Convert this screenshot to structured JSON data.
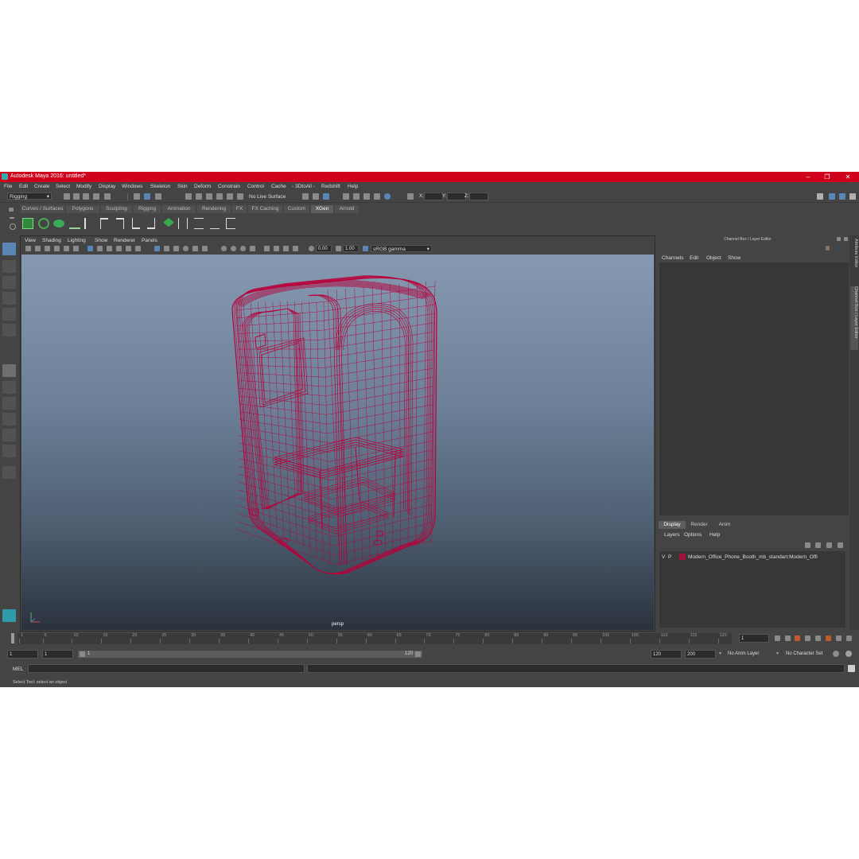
{
  "title": "Autodesk Maya 2016: untitled*",
  "window_buttons": [
    "–",
    "❐",
    "✕"
  ],
  "menu": [
    "File",
    "Edit",
    "Create",
    "Select",
    "Modify",
    "Display",
    "Windows",
    "Skeleton",
    "Skin",
    "Deform",
    "Constrain",
    "Control",
    "Cache",
    "- 3DtoAll -",
    "Redshift",
    "Help"
  ],
  "status_line": {
    "mode": "Rigging",
    "live_surface": "No Live Surface",
    "x_label": "X:",
    "y_label": "Y:",
    "z_label": "Z:"
  },
  "shelf_tabs": [
    "Curves / Surfaces",
    "Polygons",
    "Sculpting",
    "Rigging",
    "Animation",
    "Rendering",
    "FX",
    "FX Caching",
    "Custom",
    "XGen",
    "Arnold"
  ],
  "active_shelf_tab": "XGen",
  "viewport": {
    "menu": [
      "View",
      "Shading",
      "Lighting",
      "Show",
      "Renderer",
      "Panels"
    ],
    "exposure": "0.00",
    "gamma": "1.00",
    "color_space": "sRGB gamma",
    "camera_label": "persp",
    "wire_color": "#b8003a",
    "bg_top": "#8599b1",
    "bg_bottom": "#2a323d"
  },
  "channel_box": {
    "title": "Channel Box / Layer Editor",
    "menu": [
      "Channels",
      "Edit",
      "Object",
      "Show"
    ]
  },
  "side_tabs": [
    "Attribute Editor",
    "Channel Box / Layer Editor"
  ],
  "layer_editor": {
    "tabs": [
      "Display",
      "Render",
      "Anim"
    ],
    "active_tab": "Display",
    "menu": [
      "Layers",
      "Options",
      "Help"
    ],
    "layers": [
      {
        "v": "V",
        "p": "P",
        "color": "#a0103a",
        "name": "Modern_Office_Phone_Booth_mb_standart:Modern_Offi"
      }
    ]
  },
  "time_slider": {
    "labels": [
      "1",
      "5",
      "10",
      "15",
      "20",
      "25",
      "30",
      "35",
      "40",
      "45",
      "50",
      "55",
      "60",
      "65",
      "70",
      "75",
      "80",
      "85",
      "90",
      "95",
      "100",
      "105",
      "110",
      "115",
      "120"
    ],
    "current_frame": "1"
  },
  "range_slider": {
    "start": "1",
    "start2": "1",
    "range_start": "1",
    "range_end": "120",
    "end": "120",
    "end2": "200",
    "anim_layer": "No Anim Layer",
    "char_set": "No Character Set"
  },
  "command_line": {
    "label": "MEL"
  },
  "help_line": "Select Tool: select an object"
}
